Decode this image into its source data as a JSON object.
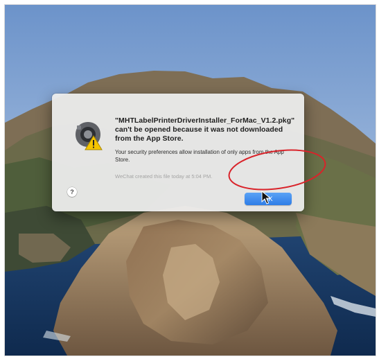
{
  "dialog": {
    "title": "\"MHTLabelPrinterDriverInstaller_ForMac_V1.2.pkg\" can't be opened because it was not downloaded from the App Store.",
    "body": "Your security preferences allow installation of only apps from the App Store.",
    "note": "WeChat created this file today at 5:04 PM.",
    "ok_label": "OK",
    "help_label": "?",
    "icon": "gatekeeper-warning-icon"
  },
  "annotation": {
    "shape": "ellipse",
    "color": "#d9232a"
  },
  "colors": {
    "button_accent": "#2e7de6",
    "warning_yellow": "#f5c400"
  }
}
